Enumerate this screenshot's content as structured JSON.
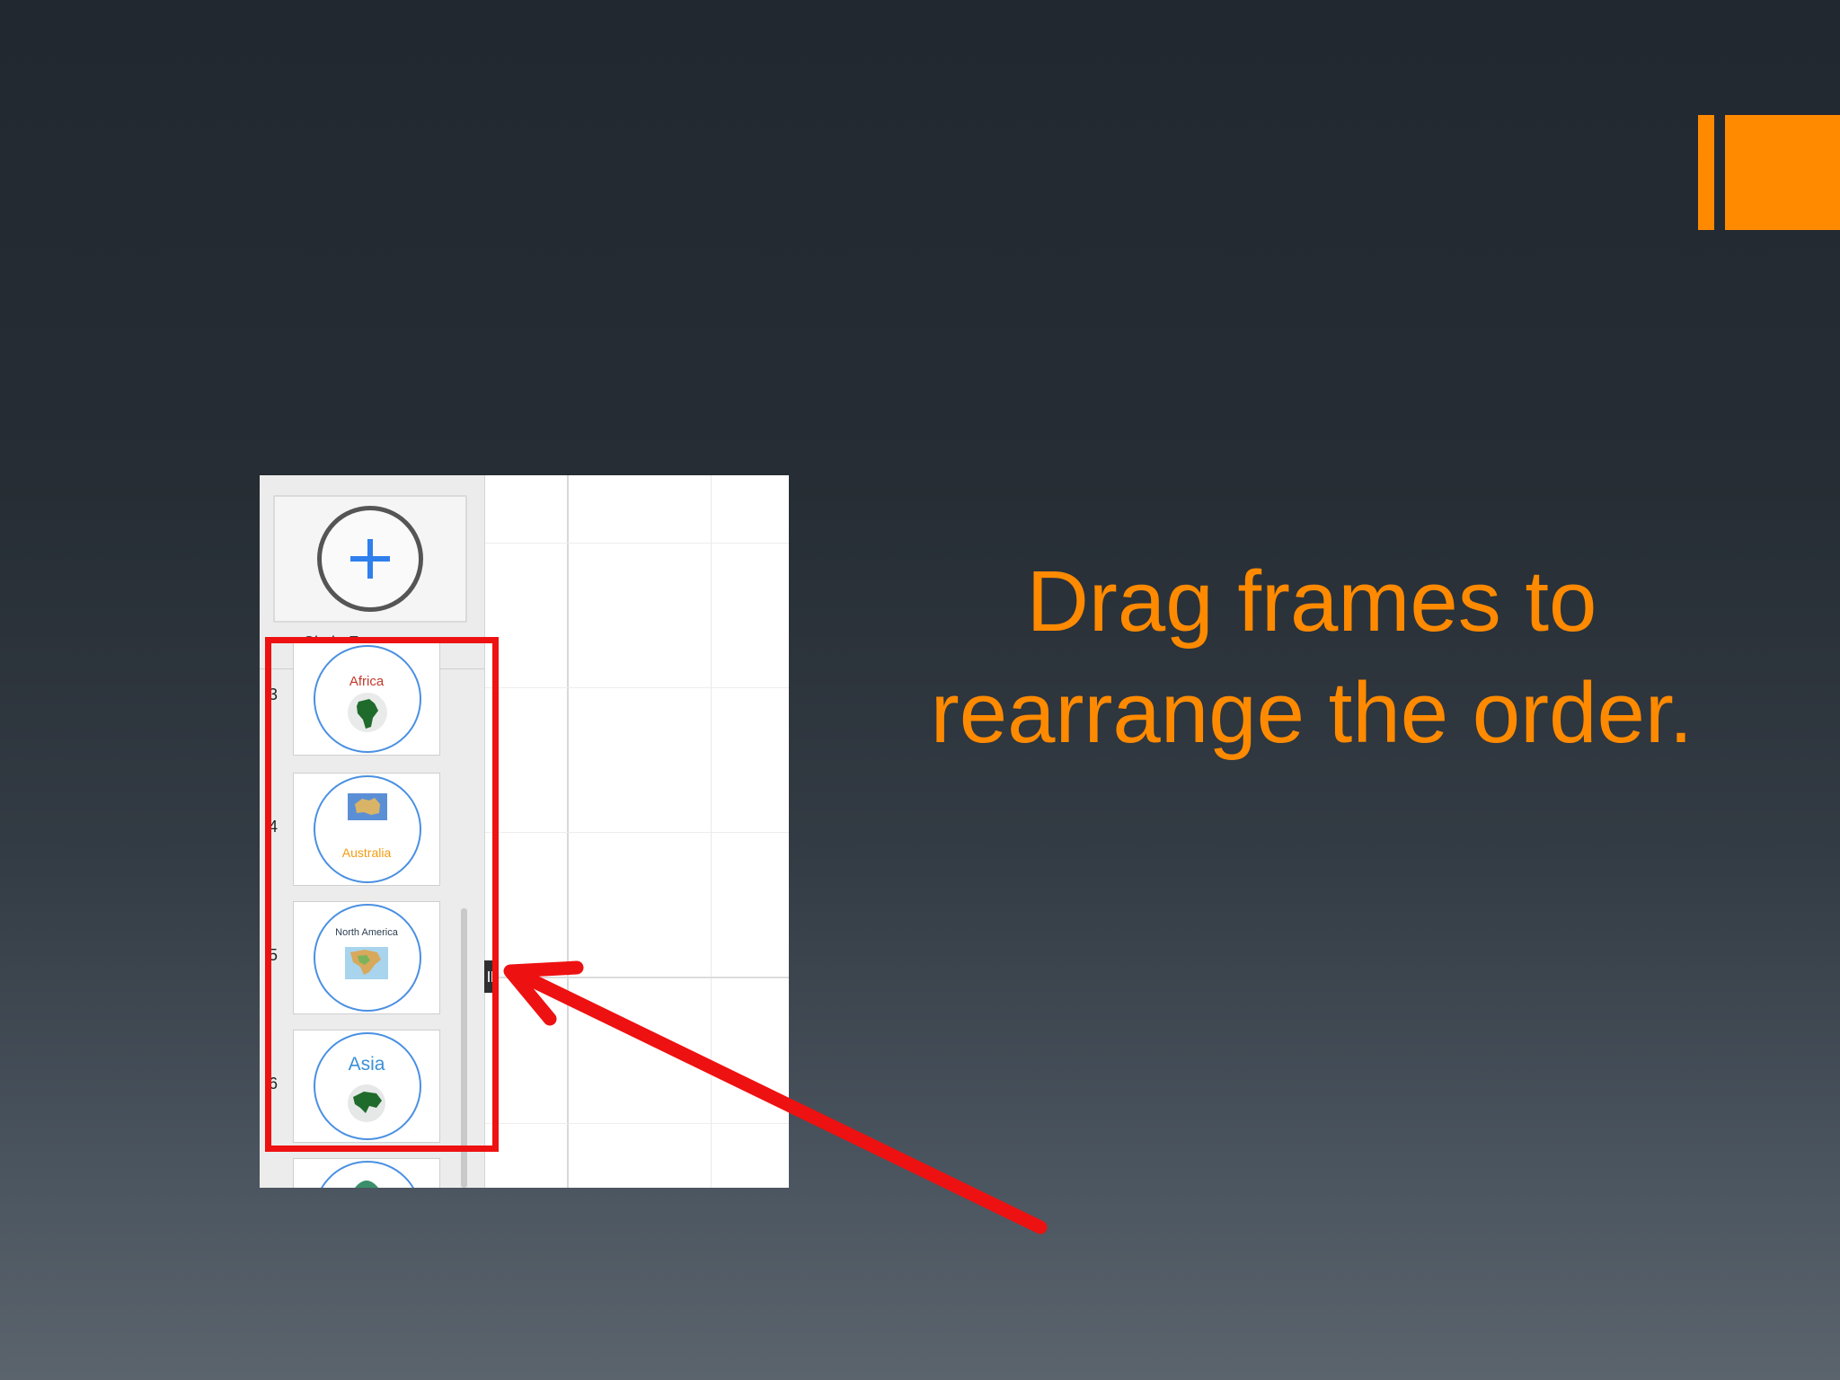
{
  "theme": {
    "accent": "#ff8a00",
    "highlight": "#ee1111",
    "frame_border": "#4a90e2"
  },
  "slide": {
    "line1": "Drag frames to",
    "line2": "rearrange the order."
  },
  "sidebar": {
    "frame_type": "Circle Frame",
    "frames": [
      {
        "number": "3",
        "label": "Africa",
        "label_color": "#c0392b"
      },
      {
        "number": "4",
        "label": "Australia",
        "label_color": "#f39c12"
      },
      {
        "number": "5",
        "label": "North America",
        "label_color": "#2c3e50"
      },
      {
        "number": "6",
        "label": "Asia",
        "label_color": "#3a8fd8"
      }
    ]
  },
  "icons": {
    "add": "plus-icon",
    "dropdown": "caret-down-icon",
    "arrow": "red-arrow-icon"
  }
}
